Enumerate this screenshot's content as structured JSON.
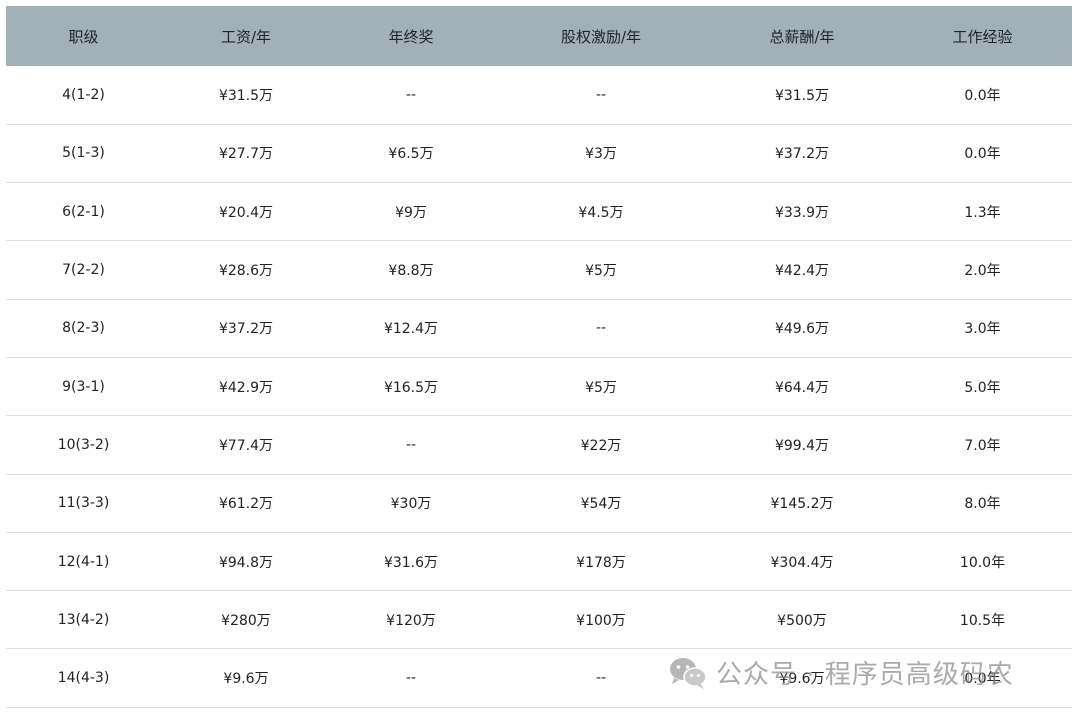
{
  "table": {
    "headers": [
      "职级",
      "工资/年",
      "年终奖",
      "股权激励/年",
      "总薪酬/年",
      "工作经验"
    ],
    "rows": [
      [
        "4(1-2)",
        "¥31.5万",
        "--",
        "--",
        "¥31.5万",
        "0.0年"
      ],
      [
        "5(1-3)",
        "¥27.7万",
        "¥6.5万",
        "¥3万",
        "¥37.2万",
        "0.0年"
      ],
      [
        "6(2-1)",
        "¥20.4万",
        "¥9万",
        "¥4.5万",
        "¥33.9万",
        "1.3年"
      ],
      [
        "7(2-2)",
        "¥28.6万",
        "¥8.8万",
        "¥5万",
        "¥42.4万",
        "2.0年"
      ],
      [
        "8(2-3)",
        "¥37.2万",
        "¥12.4万",
        "--",
        "¥49.6万",
        "3.0年"
      ],
      [
        "9(3-1)",
        "¥42.9万",
        "¥16.5万",
        "¥5万",
        "¥64.4万",
        "5.0年"
      ],
      [
        "10(3-2)",
        "¥77.4万",
        "--",
        "¥22万",
        "¥99.4万",
        "7.0年"
      ],
      [
        "11(3-3)",
        "¥61.2万",
        "¥30万",
        "¥54万",
        "¥145.2万",
        "8.0年"
      ],
      [
        "12(4-1)",
        "¥94.8万",
        "¥31.6万",
        "¥178万",
        "¥304.4万",
        "10.0年"
      ],
      [
        "13(4-2)",
        "¥280万",
        "¥120万",
        "¥100万",
        "¥500万",
        "10.5年"
      ],
      [
        "14(4-3)",
        "¥9.6万",
        "--",
        "--",
        "¥9.6万",
        "0.0年"
      ]
    ]
  },
  "watermark": {
    "text": "公众号 · 程序员高级码农",
    "icon": "wechat-icon"
  },
  "colors": {
    "header_bg": "#a2b0b8",
    "row_border": "#dcdcdc",
    "text": "#222222",
    "watermark": "#8a8a8a"
  }
}
